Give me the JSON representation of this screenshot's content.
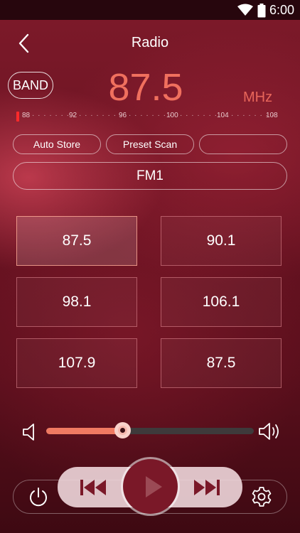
{
  "status_bar": {
    "time": "6:00"
  },
  "header": {
    "title": "Radio"
  },
  "band": {
    "label": "BAND"
  },
  "tuner": {
    "frequency": "87.5",
    "unit": "MHz",
    "scale": {
      "ticks": [
        "88",
        "92",
        "96",
        "100",
        "104",
        "108"
      ],
      "dots": "· · · · · · · ·"
    }
  },
  "actions": {
    "auto_store": "Auto Store",
    "preset_scan": "Preset Scan",
    "empty": ""
  },
  "band_tab": {
    "label": "FM1"
  },
  "presets": [
    {
      "label": "87.5"
    },
    {
      "label": "90.1"
    },
    {
      "label": "98.1"
    },
    {
      "label": "106.1"
    },
    {
      "label": "107.9"
    },
    {
      "label": "87.5"
    }
  ],
  "volume": {
    "level": 0.37
  },
  "icons": {
    "back": "chevron-left-icon",
    "volume_down": "speaker-icon",
    "volume_up": "speaker-loud-icon",
    "prev": "skip-previous-icon",
    "play": "play-icon",
    "next": "skip-next-icon",
    "power": "power-icon",
    "settings": "gear-icon"
  },
  "colors": {
    "accent": "#f0705e",
    "needle": "#ff2a2a",
    "volume_fill": "#f07a62"
  }
}
